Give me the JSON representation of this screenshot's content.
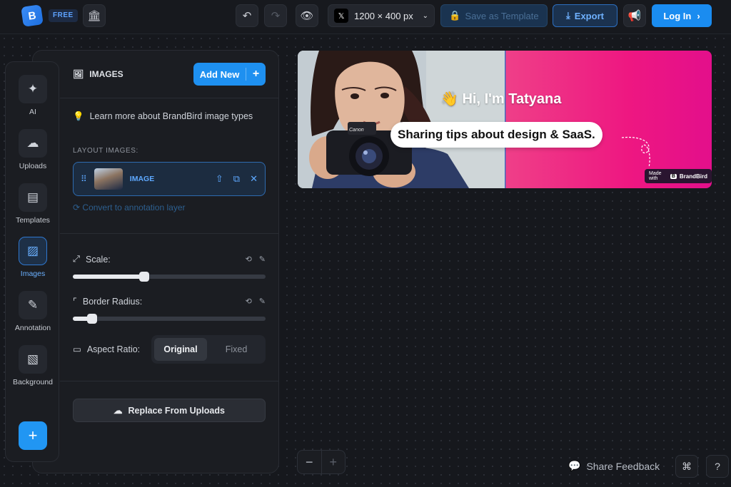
{
  "topbar": {
    "plan_badge": "FREE",
    "canvas_size": "1200 × 400 px",
    "platform_icon": "x-logo-icon",
    "save_template": "Save as Template",
    "export": "Export",
    "login": "Log In"
  },
  "rail": {
    "items": [
      {
        "label": "AI",
        "icon": "sparkles-icon"
      },
      {
        "label": "Uploads",
        "icon": "cloud-upload-icon"
      },
      {
        "label": "Templates",
        "icon": "templates-icon"
      },
      {
        "label": "Images",
        "icon": "image-icon"
      },
      {
        "label": "Annotation",
        "icon": "highlighter-icon"
      },
      {
        "label": "Background",
        "icon": "stripes-icon"
      }
    ],
    "active": "Images"
  },
  "panel": {
    "title": "IMAGES",
    "add_new": "Add New",
    "learn_more": "Learn more about BrandBird image types",
    "layout_images_label": "LAYOUT IMAGES:",
    "layer_label": "IMAGE",
    "convert_link": "Convert to annotation layer",
    "scale_label": "Scale:",
    "scale_value": 0.37,
    "border_radius_label": "Border Radius:",
    "border_radius_value": 0.1,
    "aspect_ratio_label": "Aspect Ratio:",
    "aspect_options": [
      "Original",
      "Fixed"
    ],
    "aspect_selected": "Original",
    "replace_button": "Replace From Uploads"
  },
  "banner": {
    "greeting": "👋 Hi, I'm Tatyana",
    "tagline": "Sharing tips about design & SaaS.",
    "made_with": "Made with",
    "brand": "BrandBird",
    "camera_brand": "Canon",
    "colors": {
      "left": "#c4cfd4",
      "right": "#ee1781"
    }
  },
  "footer": {
    "share_feedback": "Share Feedback"
  }
}
